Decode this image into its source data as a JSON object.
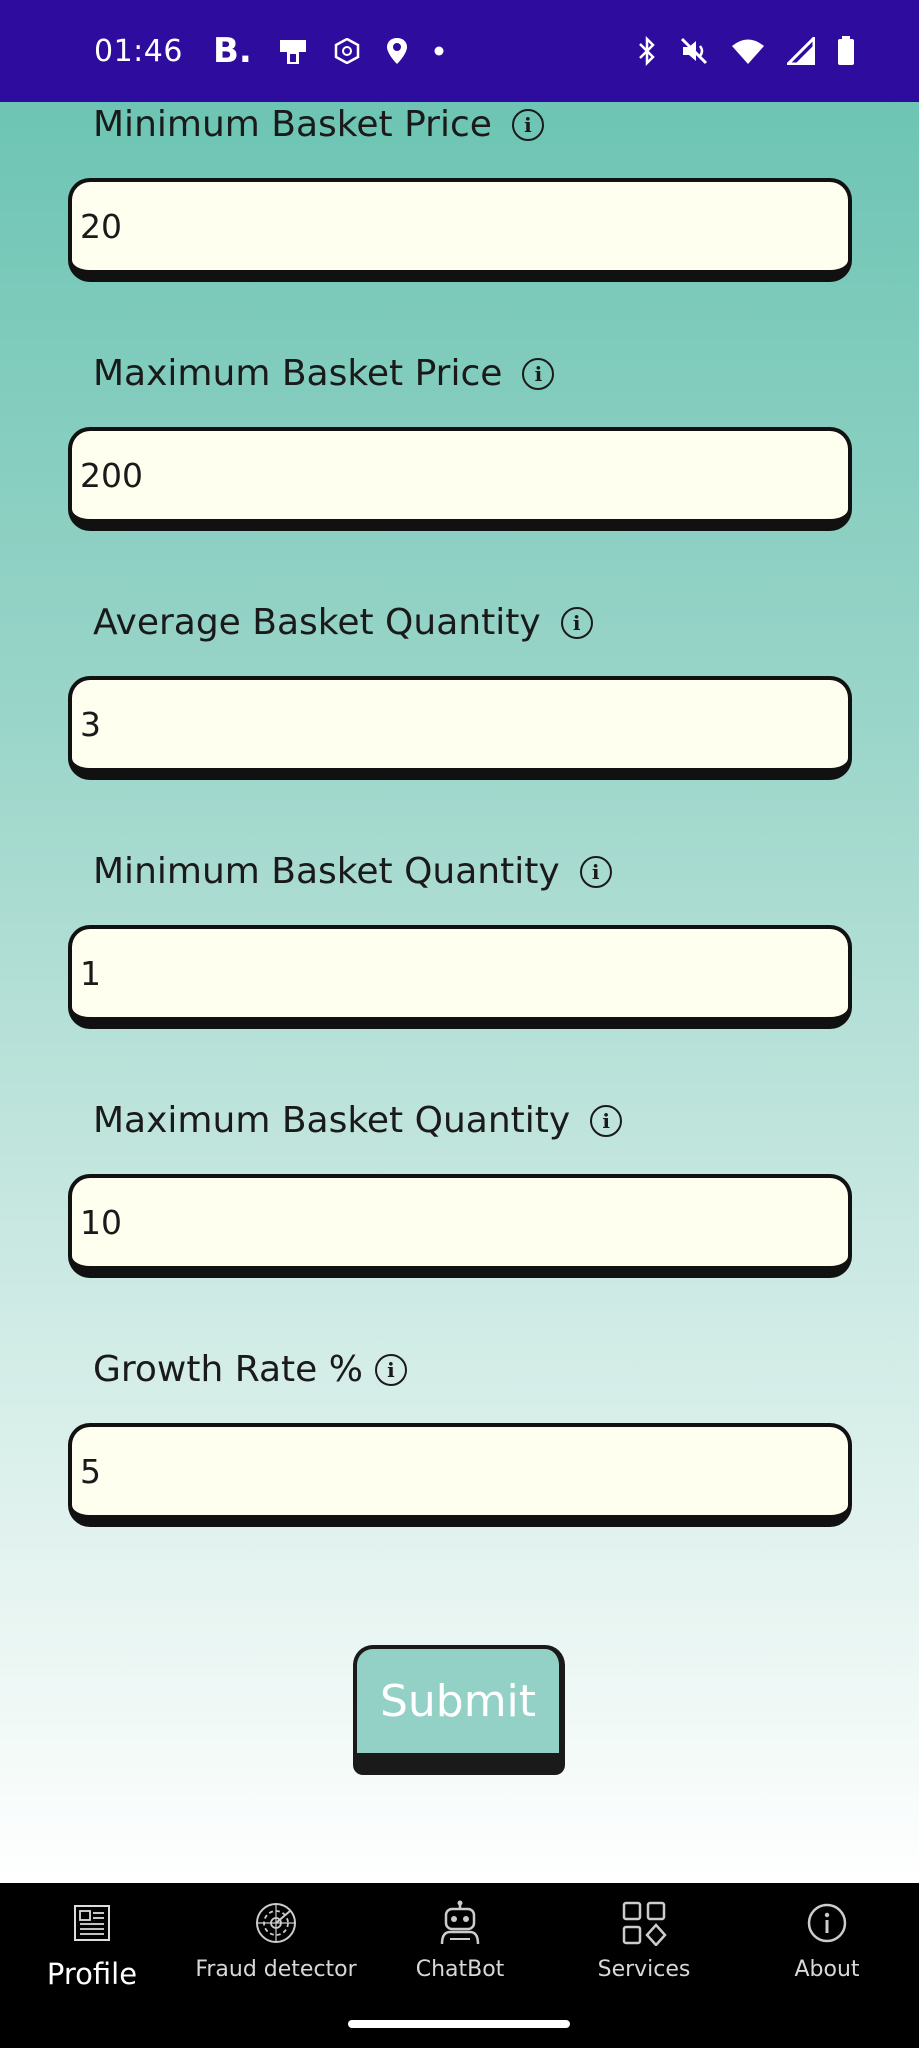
{
  "status_bar": {
    "time": "01:46",
    "brand_letter": "B.",
    "left_icons": [
      "booking-icon",
      "sim-icon",
      "assistant-icon",
      "location-icon",
      "dot-icon"
    ],
    "right_icons": [
      "bluetooth-icon",
      "mute-icon",
      "wifi-icon",
      "signal-icon",
      "battery-icon"
    ],
    "background": "#2e0c9e"
  },
  "form": {
    "fields": [
      {
        "label": "Minimum Basket Price",
        "value": "20"
      },
      {
        "label": "Maximum Basket Price",
        "value": "200"
      },
      {
        "label": "Average Basket Quantity",
        "value": "3"
      },
      {
        "label": "Minimum Basket Quantity",
        "value": "1"
      },
      {
        "label": "Maximum Basket Quantity",
        "value": "10"
      },
      {
        "label": "Growth Rate %",
        "value": "5"
      }
    ],
    "info_glyph": "i",
    "submit_label": "Submit",
    "input_background": "#fffff0",
    "button_background": "#93d1c6"
  },
  "bottom_nav": {
    "items": [
      {
        "label": "Profile",
        "icon": "newspaper-icon",
        "active": true
      },
      {
        "label": "Fraud detector",
        "icon": "radar-icon",
        "active": false
      },
      {
        "label": "ChatBot",
        "icon": "robot-icon",
        "active": false
      },
      {
        "label": "Services",
        "icon": "grid-icon",
        "active": false
      },
      {
        "label": "About",
        "icon": "info-icon",
        "active": false
      }
    ]
  }
}
